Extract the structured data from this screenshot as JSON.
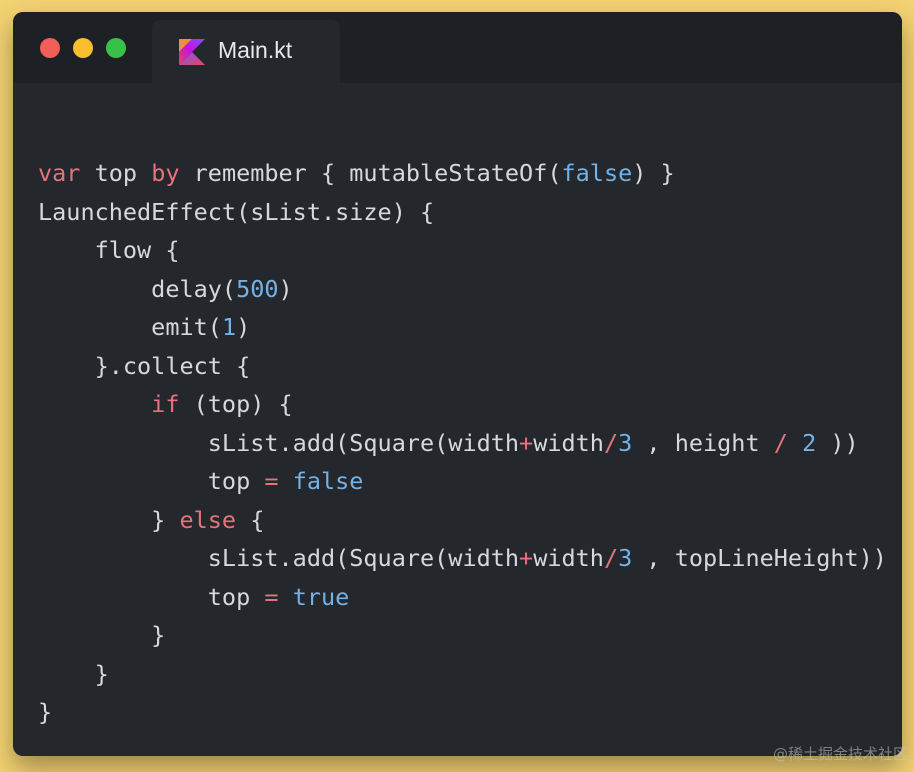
{
  "colors": {
    "background": "#f3d272",
    "window": "#24272b",
    "titlebar": "#1d2024",
    "keyword": "#e5737d",
    "number": "#73b2e8",
    "text": "#d7d8da",
    "traffic_red": "#f25f58",
    "traffic_yellow": "#fbbe2e",
    "traffic_green": "#38c149"
  },
  "window": {
    "controls": [
      "close-dot",
      "minimize-dot",
      "maximize-dot"
    ],
    "tab": {
      "icon": "kotlin-icon",
      "title": "Main.kt"
    }
  },
  "code": {
    "lines": [
      [
        {
          "t": "kw",
          "s": "var"
        },
        {
          "t": "p",
          "s": " top "
        },
        {
          "t": "kw",
          "s": "by"
        },
        {
          "t": "p",
          "s": " remember { mutableStateOf("
        },
        {
          "t": "n",
          "s": "false"
        },
        {
          "t": "p",
          "s": ") }"
        }
      ],
      [
        {
          "t": "p",
          "s": "LaunchedEffect(sList.size) {"
        }
      ],
      [
        {
          "t": "p",
          "s": "    flow {"
        }
      ],
      [
        {
          "t": "p",
          "s": "        delay("
        },
        {
          "t": "n",
          "s": "500"
        },
        {
          "t": "p",
          "s": ")"
        }
      ],
      [
        {
          "t": "p",
          "s": "        emit("
        },
        {
          "t": "n",
          "s": "1"
        },
        {
          "t": "p",
          "s": ")"
        }
      ],
      [
        {
          "t": "p",
          "s": "    }.collect {"
        }
      ],
      [
        {
          "t": "kw",
          "s": "        if"
        },
        {
          "t": "p",
          "s": " (top) {"
        }
      ],
      [
        {
          "t": "p",
          "s": "            sList.add(Square(width"
        },
        {
          "t": "kw",
          "s": "+"
        },
        {
          "t": "p",
          "s": "width"
        },
        {
          "t": "kw",
          "s": "/"
        },
        {
          "t": "n",
          "s": "3"
        },
        {
          "t": "p",
          "s": " , height "
        },
        {
          "t": "kw",
          "s": "/"
        },
        {
          "t": "p",
          "s": " "
        },
        {
          "t": "n",
          "s": "2"
        },
        {
          "t": "p",
          "s": " ))"
        }
      ],
      [
        {
          "t": "p",
          "s": "            top "
        },
        {
          "t": "kw",
          "s": "="
        },
        {
          "t": "p",
          "s": " "
        },
        {
          "t": "n",
          "s": "false"
        }
      ],
      [
        {
          "t": "p",
          "s": "        } "
        },
        {
          "t": "kw",
          "s": "else"
        },
        {
          "t": "p",
          "s": " {"
        }
      ],
      [
        {
          "t": "p",
          "s": "            sList.add(Square(width"
        },
        {
          "t": "kw",
          "s": "+"
        },
        {
          "t": "p",
          "s": "width"
        },
        {
          "t": "kw",
          "s": "/"
        },
        {
          "t": "n",
          "s": "3"
        },
        {
          "t": "p",
          "s": " , topLineHeight))"
        }
      ],
      [
        {
          "t": "p",
          "s": "            top "
        },
        {
          "t": "kw",
          "s": "="
        },
        {
          "t": "p",
          "s": " "
        },
        {
          "t": "n",
          "s": "true"
        }
      ],
      [
        {
          "t": "p",
          "s": "        }"
        }
      ],
      [
        {
          "t": "p",
          "s": "    }"
        }
      ],
      [
        {
          "t": "p",
          "s": "}"
        }
      ]
    ]
  },
  "watermark": "@稀土掘金技术社区"
}
